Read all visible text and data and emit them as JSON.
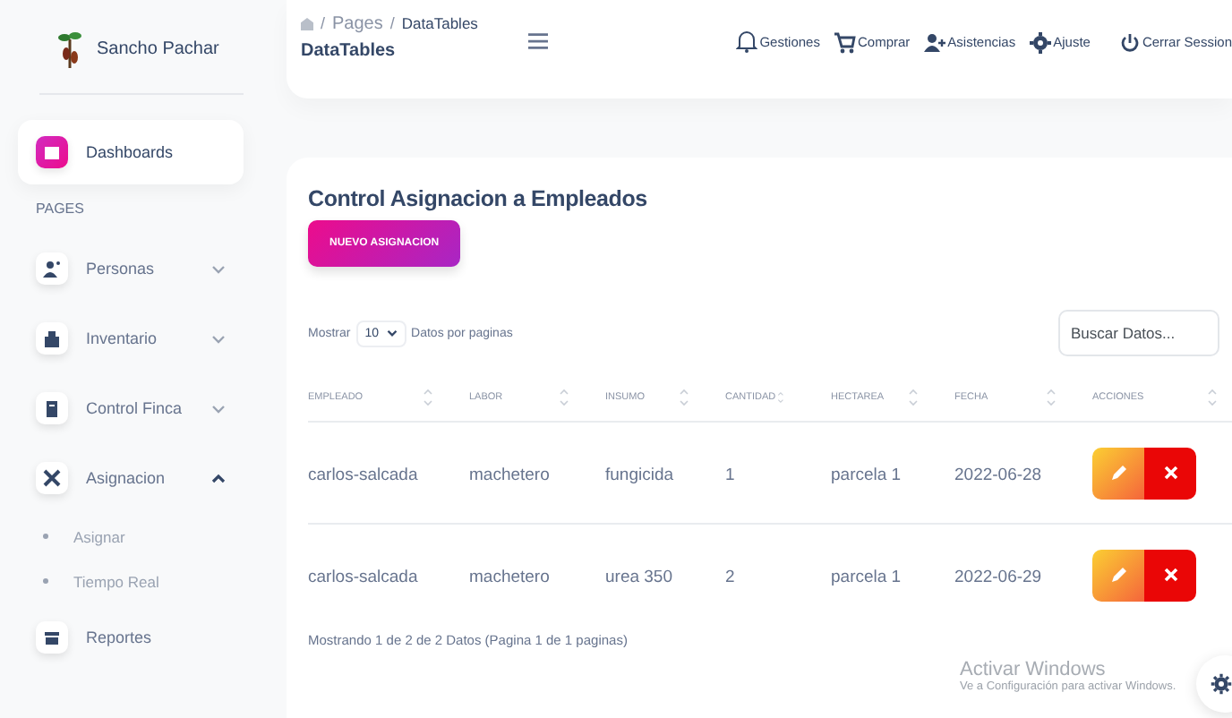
{
  "sidebar": {
    "brand": "Sancho Pachar",
    "items": [
      {
        "kind": "link",
        "label": "Dashboards",
        "selected": true
      },
      {
        "kind": "heading",
        "label": "PAGES"
      },
      {
        "kind": "group",
        "label": "Personas",
        "selected": false,
        "expanded": false
      },
      {
        "kind": "group",
        "label": "Inventario",
        "selected": false,
        "expanded": false
      },
      {
        "kind": "group",
        "label": "Control Finca",
        "selected": false,
        "expanded": false
      },
      {
        "kind": "group",
        "label": "Asignacion",
        "selected": false,
        "expanded": true,
        "children": [
          {
            "label": "Asignar"
          },
          {
            "label": "Tiempo Real"
          }
        ]
      },
      {
        "kind": "link",
        "label": "Reportes",
        "selected": false
      }
    ]
  },
  "navbar": {
    "separator": "/",
    "breadcrumb": [
      "Pages",
      "DataTables"
    ],
    "title": "DataTables",
    "links": [
      {
        "label": "Gestiones"
      },
      {
        "label": "Comprar"
      },
      {
        "label": "Asistencias"
      },
      {
        "label": "Ajuste"
      },
      {
        "label": "Cerrar Session"
      }
    ]
  },
  "card": {
    "title": "Control Asignacion a Empleados",
    "button": "NUEVO ASIGNACION",
    "length": {
      "before": "Mostrar",
      "value": "10",
      "after": "Datos por paginas"
    },
    "search": {
      "placeholder": "Buscar Datos..."
    },
    "table": {
      "columns": [
        "EMPLEADO",
        "LABOR",
        "INSUMO",
        "CANTIDAD",
        "HECTAREA",
        "FECHA",
        "ACCIONES"
      ],
      "rows": [
        [
          "carlos-salcada",
          "machetero",
          "fungicida",
          "1",
          "parcela 1",
          "2022-06-28"
        ],
        [
          "carlos-salcada",
          "machetero",
          "urea 350",
          "2",
          "parcela 1",
          "2022-06-29"
        ]
      ]
    },
    "info": "Mostrando 1 de 2 de 2 Datos (Pagina 1 de 1 paginas)"
  },
  "os_notice": {
    "title": "Activar Windows",
    "subtitle": "Ve a Configuración para activar Windows."
  }
}
